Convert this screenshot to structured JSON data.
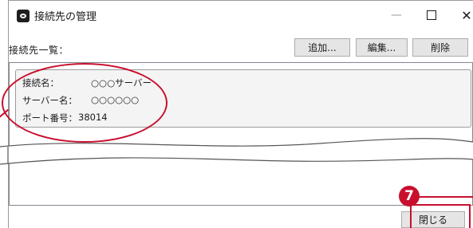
{
  "window": {
    "title": "接続先の管理",
    "minimize_glyph": "—",
    "close_glyph": "✕"
  },
  "toolbar": {
    "list_label": "接続先一覧：",
    "add_label": "追加...",
    "edit_label": "編集...",
    "delete_label": "削除"
  },
  "connection": {
    "name_label": "接続名：",
    "name_value": "○○○サーバー",
    "server_label": "サーバー名：",
    "server_value": "○○○○○○",
    "port_label": "ポート番号：",
    "port_value": "38014"
  },
  "footer": {
    "close_label": "閉じる"
  },
  "annotation": {
    "step_number": "7",
    "accent_color": "#c8102e"
  }
}
